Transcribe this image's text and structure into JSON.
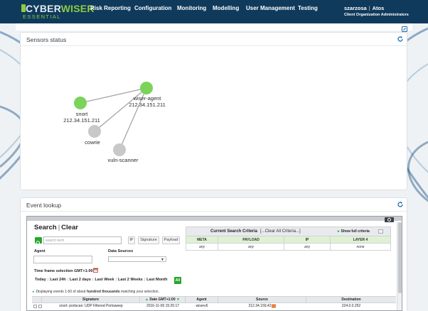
{
  "brand": {
    "name_part1": "CYBER",
    "name_part2": "WISER",
    "edition": "ESSENTIAL"
  },
  "nav": {
    "items": [
      "Risk Reporting",
      "Configuration",
      "Monitoring",
      "Modelling",
      "User Management",
      "Testing"
    ],
    "user": "szarzosa",
    "org": "Atos",
    "role": "Client Organization Administrators"
  },
  "sensors_panel": {
    "title": "Sensors status",
    "nodes": [
      {
        "name": "snort",
        "ip": "212.34.151.211",
        "status": "online",
        "color": "#7bd35a"
      },
      {
        "name": "wiser-agent",
        "ip": "212.34.151.211",
        "status": "online",
        "color": "#7bd35a"
      },
      {
        "name": "cowrie",
        "ip": "",
        "status": "offline",
        "color": "#c8c8c8"
      },
      {
        "name": "vuln-scanner",
        "ip": "",
        "status": "offline",
        "color": "#c8c8c8"
      }
    ],
    "edge_color": "#a0a0a0"
  },
  "event_panel": {
    "title": "Event lookup",
    "search": {
      "title": "Search",
      "clear": "Clear",
      "placeholder": "search term",
      "btn_ip": "IP",
      "btn_signature": "Signature",
      "btn_payload": "Payload",
      "agent_label": "Agent",
      "sources_label": "Data Sources",
      "timeframe_label": "Time frame selection GMT+1:00:",
      "ranges": [
        "Today",
        "Last 24h",
        "Last 2 days",
        "Last Week",
        "Last 2 Weeks",
        "Last Month"
      ],
      "all_label": "All"
    },
    "criteria": {
      "title": "Current Search Criteria",
      "clear_all": "[...Clear All Criteria...]",
      "show_full": "Show full criteria",
      "columns": [
        "META",
        "PAYLOAD",
        "IP",
        "LAYER 4"
      ],
      "values": [
        "any",
        "any",
        "any",
        "none"
      ]
    },
    "display_info": {
      "prefix": "Displaying events 1-50 of about",
      "bold": "hundred thousands",
      "suffix": "matching your selection."
    },
    "table": {
      "headers": [
        "Signature",
        "Date GMT+1:00",
        "Agent",
        "Source",
        "Destination"
      ],
      "rows": [
        {
          "signature": "snort: portscan: UDP Filtered Portsweep",
          "date": "2016-11-09 15:20:17",
          "agent": "wiserv6",
          "source": "212.34.159.42",
          "destination": "224.0.0.252"
        }
      ]
    }
  },
  "colors": {
    "navbar": "#0f3a5c",
    "accent_green": "#27a62c",
    "logo_green": "#8fcb3f",
    "link_blue": "#1f6fb2"
  }
}
